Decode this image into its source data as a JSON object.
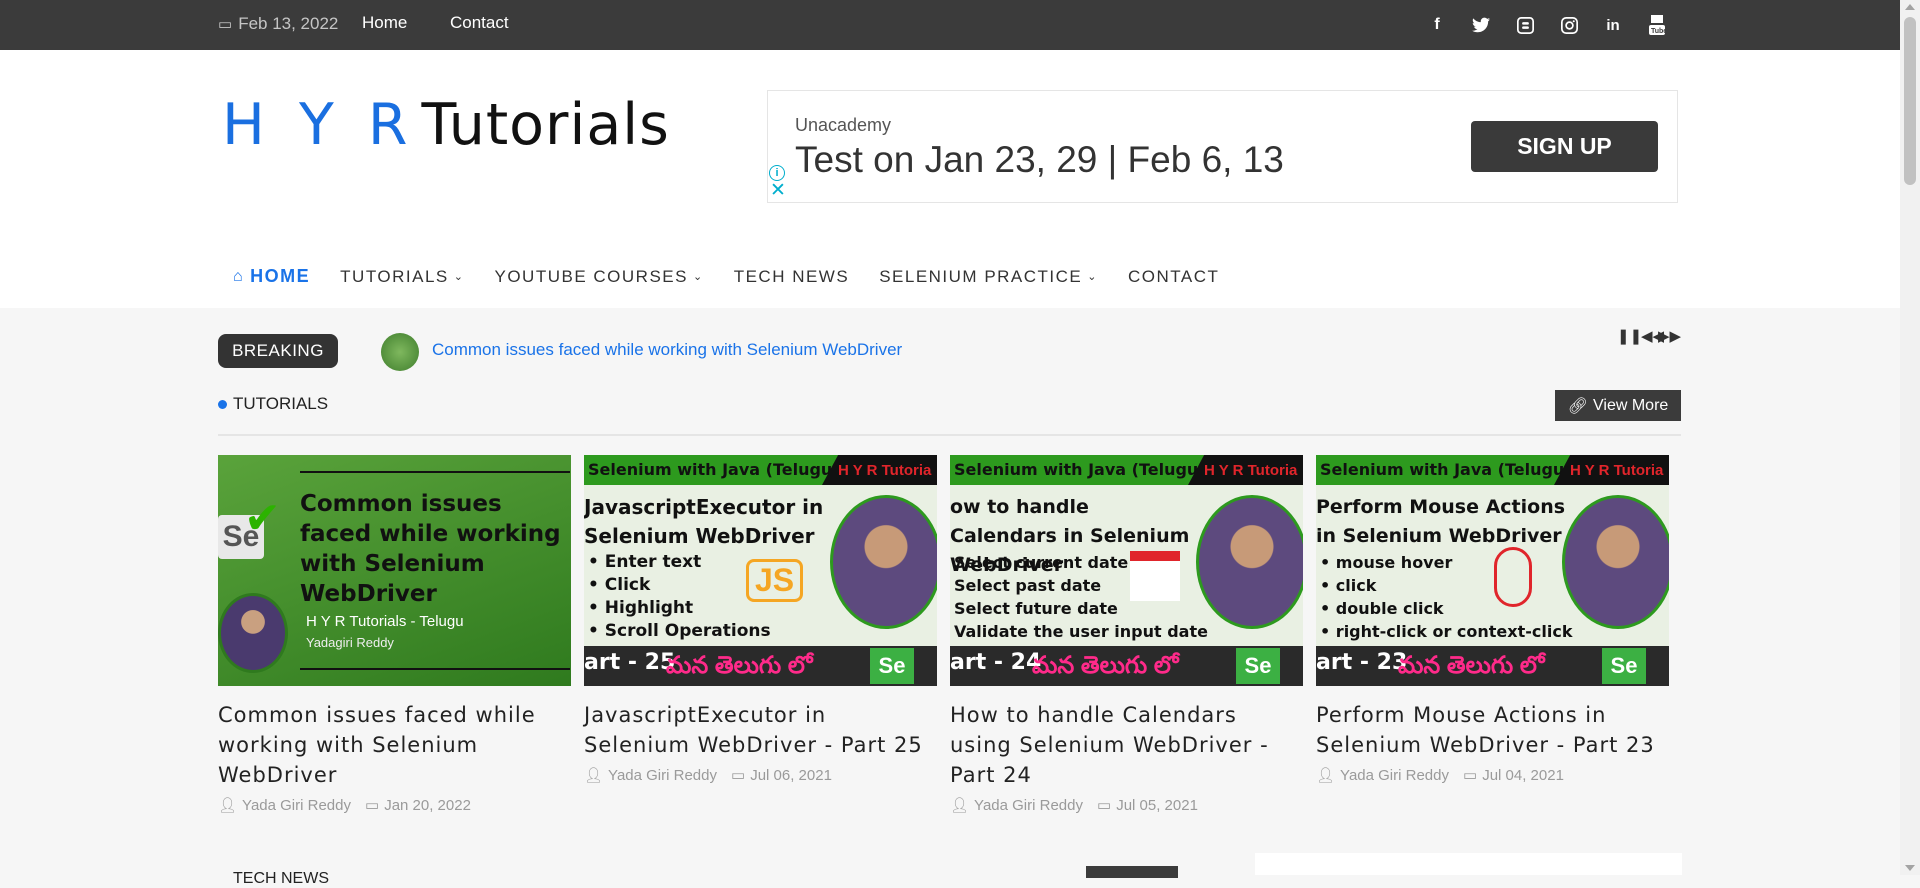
{
  "topbar": {
    "date": "Feb 13, 2022",
    "links": [
      "Home",
      "Contact"
    ],
    "social_icons": [
      "facebook-icon",
      "twitter-icon",
      "blogger-icon",
      "instagram-icon",
      "linkedin-icon",
      "youtube-icon"
    ]
  },
  "logo": {
    "part1": "H Y R",
    "part2": "Tutorials"
  },
  "ad": {
    "brand": "Unacademy",
    "headline": "Test on Jan 23, 29 | Feb 6, 13",
    "cta": "SIGN UP"
  },
  "nav": {
    "items": [
      {
        "label": "HOME",
        "active": true,
        "dropdown": false
      },
      {
        "label": "TUTORIALS",
        "active": false,
        "dropdown": true
      },
      {
        "label": "YOUTUBE COURSES",
        "active": false,
        "dropdown": true
      },
      {
        "label": "TECH NEWS",
        "active": false,
        "dropdown": false
      },
      {
        "label": "SELENIUM PRACTICE",
        "active": false,
        "dropdown": true
      },
      {
        "label": "CONTACT",
        "active": false,
        "dropdown": false
      }
    ]
  },
  "ticker": {
    "label": "BREAKING",
    "headline": "Common issues faced while working with Selenium WebDriver"
  },
  "section": {
    "title": "TUTORIALS",
    "view_more": "View More"
  },
  "cards": [
    {
      "thumb_title": "Common issues faced while working with Selenium WebDriver",
      "thumb_sub": "H Y R Tutorials - Telugu",
      "thumb_sub2": "Yadagiri Reddy",
      "title": "Common issues faced while working with Selenium WebDriver",
      "author": "Yada Giri Reddy",
      "date": "Jan 20, 2022"
    },
    {
      "band_left": "Selenium with Java (Telugu)",
      "band_right": "H Y R Tutoria",
      "thumb_title": "JavascriptExecutor in Selenium WebDriver",
      "bullets": [
        "• Enter text",
        "• Click",
        "• Highlight",
        "• Scroll Operations"
      ],
      "part": "art - 25",
      "telugu": "మన తెలుగు లో",
      "title": "JavascriptExecutor in Selenium WebDriver - Part 25",
      "author": "Yada Giri Reddy",
      "date": "Jul 06, 2021"
    },
    {
      "band_left": "Selenium with Java (Telugu)",
      "band_right": "H Y R Tutoria",
      "thumb_title": "ow to handle Calendars in Selenium WebDriver",
      "bullets": [
        "Select current date",
        "Select past date",
        "Select future date",
        "Validate the user input date"
      ],
      "part": "art - 24",
      "telugu": "మన తెలుగు లో",
      "title": "How to handle Calendars using Selenium WebDriver - Part 24",
      "author": "Yada Giri Reddy",
      "date": "Jul 05, 2021"
    },
    {
      "band_left": "Selenium with Java (Telugu)",
      "band_right": "H Y R Tutoria",
      "thumb_title": "Perform Mouse Actions in Selenium WebDriver",
      "bullets": [
        "• mouse hover",
        "• click",
        "• double click",
        "• right-click or context-click"
      ],
      "part": "art - 23",
      "telugu": "మన తెలుగు లో",
      "title": "Perform Mouse Actions in Selenium WebDriver - Part 23",
      "author": "Yada Giri Reddy",
      "date": "Jul 04, 2021"
    }
  ],
  "lower": {
    "section_title": "TECH NEWS"
  },
  "colors": {
    "accent": "#1a73e8",
    "dark": "#3b3b3b"
  }
}
